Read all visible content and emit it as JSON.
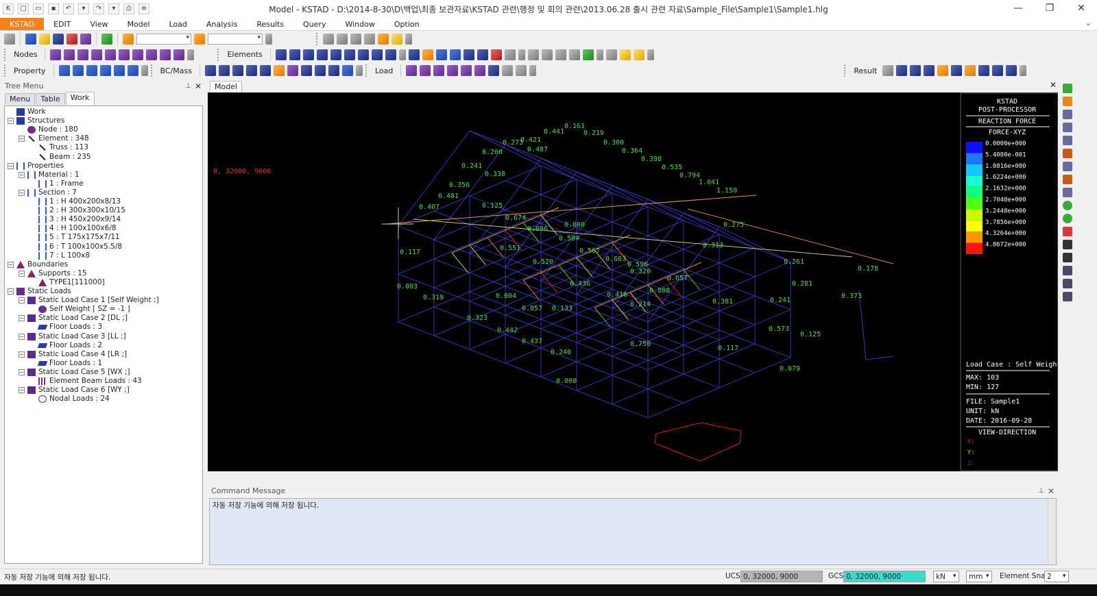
{
  "window": {
    "title": "Model - KSTAD - D:\\2014-8-30\\D\\백업\\최종 보관자료\\KSTAD 관련\\행정 및 회의 관련\\2013.06.28 출시 관련 자료\\Sample_File\\Sample1\\Sample1.hlg",
    "minimize": "—",
    "restore": "❐",
    "close": "✕"
  },
  "menu": {
    "items": [
      "KSTAD",
      "EDIT",
      "View",
      "Model",
      "Load",
      "Analysis",
      "Results",
      "Query",
      "Window",
      "Option"
    ],
    "active": "KSTAD"
  },
  "toolbars": {
    "nodes_label": "Nodes",
    "elements_label": "Elements",
    "property_label": "Property",
    "bcmass_label": "BC/Mass",
    "load_label": "Load",
    "result_label": "Result"
  },
  "tree": {
    "header": "Tree Menu",
    "tabs": [
      "Menu",
      "Table",
      "Work"
    ],
    "active_tab": "Work",
    "rows": [
      {
        "label": "Work",
        "icon": "work-icon",
        "level": 0,
        "toggle": ""
      },
      {
        "label": "Structures",
        "icon": "structures-icon",
        "level": 0,
        "toggle": "−"
      },
      {
        "label": "Node : 180",
        "icon": "node-icon",
        "level": 1,
        "toggle": ""
      },
      {
        "label": "Element : 348",
        "icon": "element-icon",
        "level": 1,
        "toggle": "−"
      },
      {
        "label": "Truss : 113",
        "icon": "truss-icon",
        "level": 2,
        "toggle": ""
      },
      {
        "label": "Beam : 235",
        "icon": "beam-icon",
        "level": 2,
        "toggle": ""
      },
      {
        "label": "Properties",
        "icon": "properties-icon",
        "level": 0,
        "toggle": "−"
      },
      {
        "label": "Material : 1",
        "icon": "material-icon",
        "level": 1,
        "toggle": "−"
      },
      {
        "label": "1 : Frame",
        "icon": "frame-icon",
        "level": 2,
        "toggle": ""
      },
      {
        "label": "Section : 7",
        "icon": "section-icon",
        "level": 1,
        "toggle": "−"
      },
      {
        "label": "1 : H 400x200x8/13",
        "icon": "h-section-icon",
        "level": 2,
        "toggle": ""
      },
      {
        "label": "2 : H 300x300x10/15",
        "icon": "h-section-icon",
        "level": 2,
        "toggle": ""
      },
      {
        "label": "3 : H 450x200x9/14",
        "icon": "h-section-icon",
        "level": 2,
        "toggle": ""
      },
      {
        "label": "4 : H 100x100x6/8",
        "icon": "h-section-icon",
        "level": 2,
        "toggle": ""
      },
      {
        "label": "5 : T 175x175x7/11",
        "icon": "t-section-icon",
        "level": 2,
        "toggle": ""
      },
      {
        "label": "6 : T 100x100x5.5/8",
        "icon": "t-section-icon",
        "level": 2,
        "toggle": ""
      },
      {
        "label": "7 : L 100x8",
        "icon": "l-section-icon",
        "level": 2,
        "toggle": ""
      },
      {
        "label": "Boundaries",
        "icon": "boundaries-icon",
        "level": 0,
        "toggle": "−"
      },
      {
        "label": "Supports : 15",
        "icon": "supports-icon",
        "level": 1,
        "toggle": "−"
      },
      {
        "label": "TYPE1[111000]",
        "icon": "support-type-icon",
        "level": 2,
        "toggle": ""
      },
      {
        "label": "Static Loads",
        "icon": "static-loads-icon",
        "level": 0,
        "toggle": "−"
      },
      {
        "label": "Static Load Case 1 [Self Weight ;]",
        "icon": "load-case-icon",
        "level": 1,
        "toggle": "−"
      },
      {
        "label": "Self Weight [ SZ = -1 ]",
        "icon": "self-weight-icon",
        "level": 2,
        "toggle": ""
      },
      {
        "label": "Static Load Case 2 [DL ;]",
        "icon": "load-case-icon",
        "level": 1,
        "toggle": "−"
      },
      {
        "label": "Floor Loads : 3",
        "icon": "floor-load-icon",
        "level": 2,
        "toggle": ""
      },
      {
        "label": "Static Load Case 3 [LL ;]",
        "icon": "load-case-icon",
        "level": 1,
        "toggle": "−"
      },
      {
        "label": "Floor Loads : 2",
        "icon": "floor-load-icon",
        "level": 2,
        "toggle": ""
      },
      {
        "label": "Static Load Case 4 [LR ;]",
        "icon": "load-case-icon",
        "level": 1,
        "toggle": "−"
      },
      {
        "label": "Floor Loads : 1",
        "icon": "floor-load-icon",
        "level": 2,
        "toggle": ""
      },
      {
        "label": "Static Load Case 5 [WX ;]",
        "icon": "load-case-icon",
        "level": 1,
        "toggle": "−"
      },
      {
        "label": "Element Beam Loads : 43",
        "icon": "beam-load-icon",
        "level": 2,
        "toggle": ""
      },
      {
        "label": "Static Load Case 6 [WY ;]",
        "icon": "load-case-icon",
        "level": 1,
        "toggle": "−"
      },
      {
        "label": "Nodal Loads : 24",
        "icon": "nodal-load-icon",
        "level": 2,
        "toggle": ""
      }
    ]
  },
  "model_tab": "Model",
  "viewport": {
    "coord_readout": "0, 32000, 9000",
    "legend": {
      "header1": "KSTAD",
      "header2": "POST-PROCESSOR",
      "result_type": "REACTION FORCE",
      "component": "FORCE-XYZ",
      "values": [
        "0.0000e+000",
        "5.4080e-001",
        "1.0816e+000",
        "1.6224e+000",
        "2.1632e+000",
        "2.7040e+000",
        "3.2448e+000",
        "3.7856e+000",
        "4.3264e+000",
        "4.8672e+000"
      ],
      "colors": [
        "#1010ff",
        "#1e78ff",
        "#14c8ff",
        "#14ffd2",
        "#14ff78",
        "#50ff14",
        "#c8ff00",
        "#ffff00",
        "#ff9600",
        "#ff1414"
      ],
      "load_case": "Load Case : Self Weight",
      "max": "MAX: 103",
      "min": "MIN: 127",
      "file": "FILE: Sample1",
      "unit": "UNIT: kN",
      "date": "DATE: 2016-09-28",
      "view_direction": "VIEW-DIRECTION",
      "axes": [
        "X:",
        "Y:",
        "Z:"
      ]
    },
    "labels": [
      "0.161",
      "0.219",
      "0.300",
      "0.364",
      "0.398",
      "0.535",
      "0.794",
      "1.041",
      "1.150",
      "0.441",
      "0.421",
      "0.487",
      "0.273",
      "0.200",
      "0.241",
      "0.338",
      "0.356",
      "0.481",
      "0.407",
      "0.125",
      "0.674",
      "0.896",
      "0.504",
      "0.000",
      "0.551",
      "0.520",
      "0.567",
      "0.436",
      "0.320",
      "0.416",
      "0.214",
      "0.004",
      "0.133",
      "0.117",
      "0.003",
      "0.319",
      "0.857",
      "0.323",
      "0.442",
      "0.437",
      "0.240",
      "0.000",
      "0.079",
      "0.178",
      "0.573",
      "0.241",
      "0.313",
      "0.275",
      "0.657",
      "0.596",
      "0.808",
      "0.750",
      "0.381",
      "0.117",
      "0.281",
      "0.663",
      "0.125",
      "0.373",
      "0.261"
    ]
  },
  "command": {
    "header": "Command Message",
    "message": "자동 저장 기능에 의해 저장 됩니다."
  },
  "status": {
    "message": "자동 저장 기능에 의해 저장 됩니다.",
    "ucs_label": "UCS",
    "ucs_value": "0, 32000, 9000",
    "gcs_label": "GCS",
    "gcs_value": "0, 32000, 9000",
    "unit_force": "kN",
    "unit_length": "mm",
    "snap_label": "Element Snap",
    "snap_value": "2"
  }
}
